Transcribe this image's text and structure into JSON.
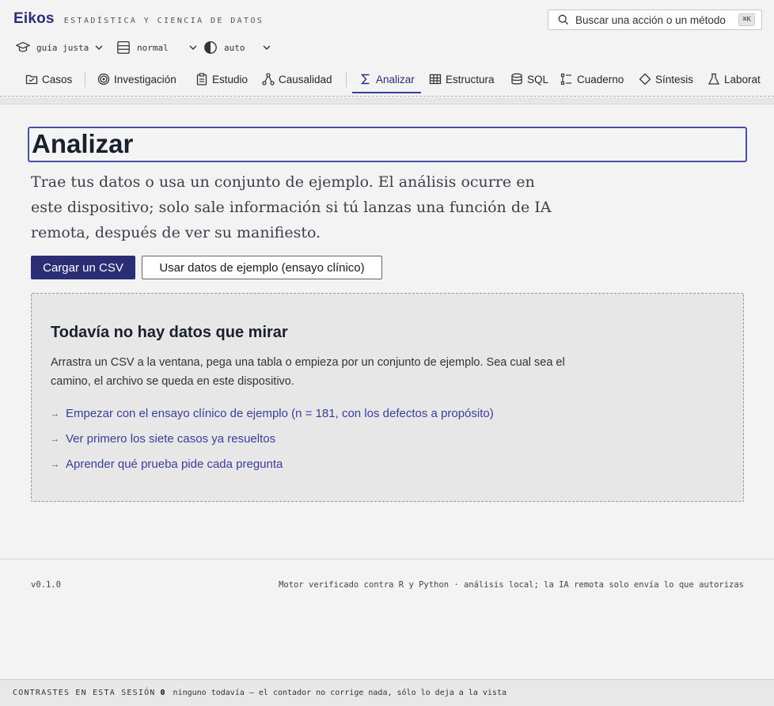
{
  "app": {
    "name": "Eikos",
    "tagline": "ESTADÍSTICA Y CIENCIA DE DATOS"
  },
  "search": {
    "placeholder": "Buscar una acción o un método",
    "shortcut": "⌘K"
  },
  "prefs": [
    {
      "icon": "graduation-cap-icon",
      "value": "guía justa"
    },
    {
      "icon": "list-icon",
      "value": "normal"
    },
    {
      "icon": "contrast-icon",
      "value": "auto"
    }
  ],
  "nav": {
    "tabs": [
      {
        "label": "Casos",
        "icon": "folder-icon"
      },
      {
        "label": "Investigación",
        "icon": "target-icon"
      },
      {
        "label": "Estudio",
        "icon": "clipboard-icon"
      },
      {
        "label": "Causalidad",
        "icon": "graph-icon"
      },
      {
        "label": "Analizar",
        "icon": "sigma-icon",
        "active": true
      },
      {
        "label": "Estructura",
        "icon": "table-icon"
      },
      {
        "label": "SQL",
        "icon": "database-icon"
      },
      {
        "label": "Cuaderno",
        "icon": "notebook-icon"
      },
      {
        "label": "Síntesis",
        "icon": "diamond-icon"
      },
      {
        "label": "Laborat",
        "icon": "flask-icon"
      }
    ]
  },
  "main": {
    "title": "Analizar",
    "lede": "Trae tus datos o usa un conjunto de ejemplo. El análisis ocurre en este dispositivo; solo sale información si tú lanzas una función de IA remota, después de ver su manifiesto.",
    "upload_label": "Cargar un CSV",
    "sample_label": "Usar datos de ejemplo (ensayo clínico)"
  },
  "empty_state": {
    "title": "Todavía no hay datos que mirar",
    "body": "Arrastra un CSV a la ventana, pega una tabla o empieza por un conjunto de ejemplo. Sea cual sea el camino, el archivo se queda en este dispositivo.",
    "arrow": "→",
    "links": [
      "Empezar con el ensayo clínico de ejemplo (n = 181, con los defectos a propósito)",
      "Ver primero los siete casos ya resueltos",
      "Aprender qué prueba pide cada pregunta"
    ]
  },
  "footer": {
    "version": "v0.1.0",
    "engine": "Motor verificado contra R y Python · análisis local; la IA remota solo envía lo que autorizas"
  },
  "status": {
    "label": "CONTRASTES EN ESTA SESIÓN",
    "count": "0",
    "note": "ninguno todavía — el contador no corrige nada, sólo lo deja a la vista"
  },
  "colors": {
    "accent": "#2b2d75",
    "link": "#3a3d9c",
    "title_border": "#4a4ea8"
  }
}
